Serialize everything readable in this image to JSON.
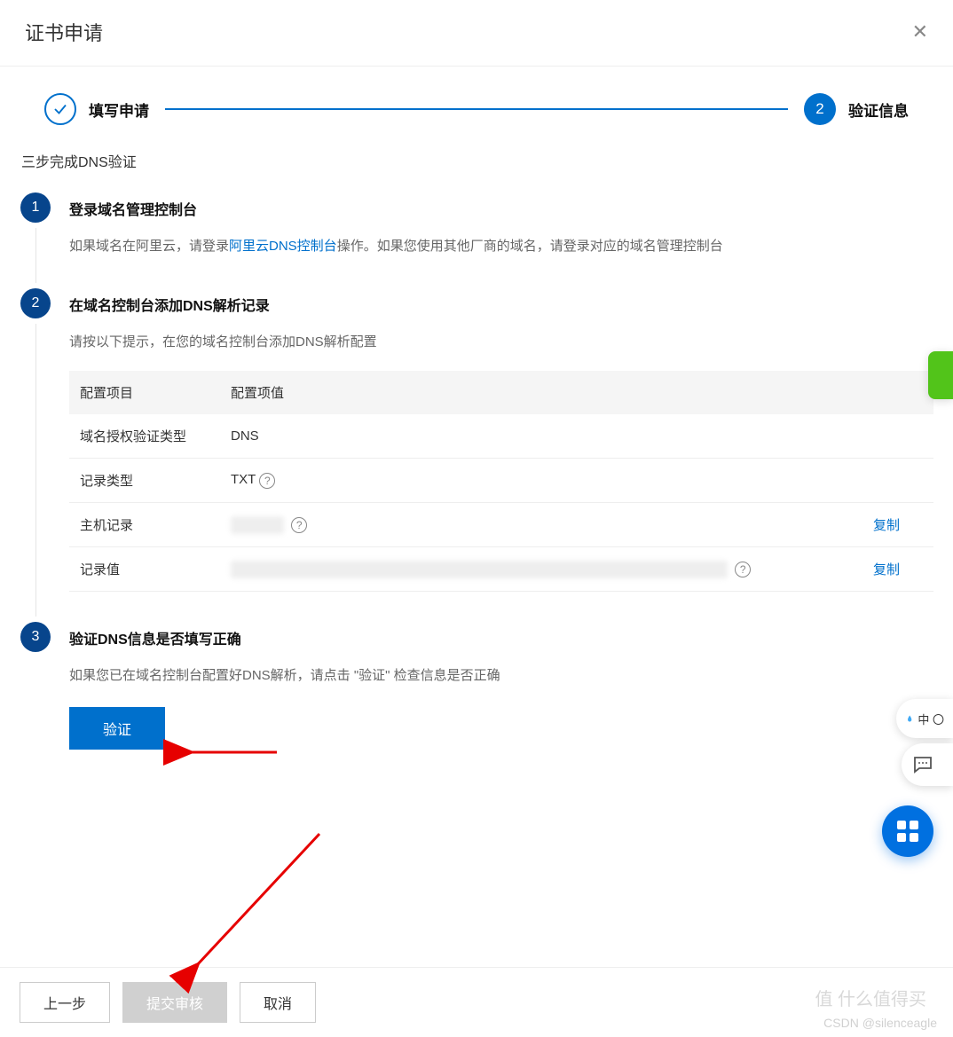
{
  "modal": {
    "title": "证书申请"
  },
  "stepper": {
    "step1_label": "填写申请",
    "step2_num": "2",
    "step2_label": "验证信息"
  },
  "subtitle": "三步完成DNS验证",
  "steps": {
    "s1": {
      "num": "1",
      "title": "登录域名管理控制台",
      "desc_prefix": "如果域名在阿里云，请登录",
      "desc_link": "阿里云DNS控制台",
      "desc_suffix": "操作。如果您使用其他厂商的域名，请登录对应的域名管理控制台"
    },
    "s2": {
      "num": "2",
      "title": "在域名控制台添加DNS解析记录",
      "desc": "请按以下提示，在您的域名控制台添加DNS解析配置",
      "table": {
        "head_key": "配置项目",
        "head_val": "配置项值",
        "row1_key": "域名授权验证类型",
        "row1_val": "DNS",
        "row2_key": "记录类型",
        "row2_val": "TXT",
        "row3_key": "主机记录",
        "row3_copy": "复制",
        "row4_key": "记录值",
        "row4_copy": "复制"
      }
    },
    "s3": {
      "num": "3",
      "title": "验证DNS信息是否填写正确",
      "desc": "如果您已在域名控制台配置好DNS解析，请点击 \"验证\" 检查信息是否正确",
      "verify_btn": "验证"
    }
  },
  "footer": {
    "prev": "上一步",
    "submit": "提交审核",
    "cancel": "取消"
  },
  "side": {
    "ime": "中 〇"
  },
  "watermarks": {
    "w1": "值  什么值得买",
    "w2": "CSDN @silenceagle"
  }
}
